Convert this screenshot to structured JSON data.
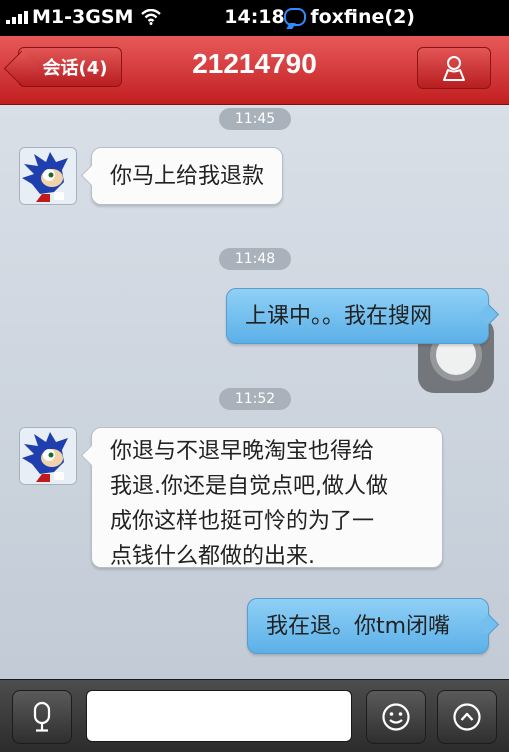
{
  "status_bar": {
    "carrier": "M1-3GSM",
    "time": "14:18",
    "notification": "foxfine(2)"
  },
  "nav": {
    "back_label": "会话(4)",
    "title": "21214790",
    "profile_icon": "person-icon"
  },
  "messages": [
    {
      "type": "timestamp",
      "text": "11:45"
    },
    {
      "type": "incoming",
      "text": "你马上给我退款"
    },
    {
      "type": "timestamp",
      "text": "11:48"
    },
    {
      "type": "outgoing",
      "text": "上课中。。我在搜网"
    },
    {
      "type": "timestamp",
      "text": "11:52"
    },
    {
      "type": "incoming",
      "lines": [
        "你退与不退早晚淘宝也得给",
        "我退.你还是自觉点吧,做人做",
        "成你这样也挺可怜的为了一",
        "点钱什么都做的出来."
      ]
    },
    {
      "type": "outgoing",
      "text": "我在退。你tm闭嘴"
    }
  ],
  "input_bar": {
    "voice_icon": "microphone-icon",
    "input_value": "",
    "emoji_icon": "smiley-icon",
    "more_icon": "chevron-up-icon"
  },
  "colors": {
    "nav_red": "#c21f21",
    "outgoing_bubble": "#6fbcee",
    "incoming_bubble": "#fbfbfb"
  }
}
